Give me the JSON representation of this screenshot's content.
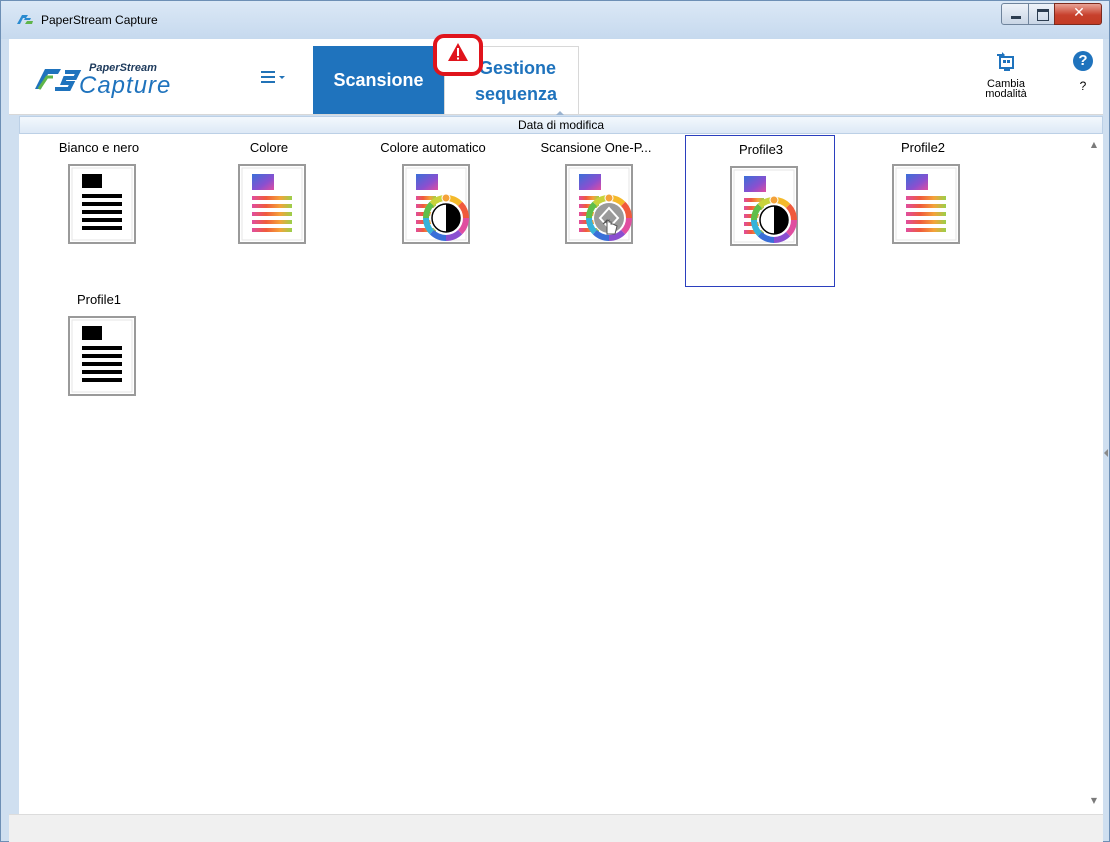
{
  "window": {
    "title": "PaperStream Capture"
  },
  "logo": {
    "top": "PaperStream",
    "bottom": "Capture"
  },
  "toolbar": {
    "menu_icon": "hamburger-menu-icon",
    "tab_scan": "Scansione",
    "tab_seq_line1": "Gestione",
    "tab_seq_line2": "sequenza",
    "mode_line1": "Cambia",
    "mode_line2": "modalità",
    "help_symbol": "?",
    "help_label": "?"
  },
  "sort": {
    "label": "Data di modifica"
  },
  "profiles": [
    {
      "label": "Bianco e nero",
      "icon": "bw-document-icon"
    },
    {
      "label": "Colore",
      "icon": "color-document-icon"
    },
    {
      "label": "Colore automatico",
      "icon": "auto-color-document-icon"
    },
    {
      "label": "Scansione One-P...",
      "icon": "one-push-scan-icon"
    },
    {
      "label": "Profile3",
      "icon": "auto-color-document-icon",
      "selected": true
    },
    {
      "label": "Profile2",
      "icon": "color-document-icon"
    },
    {
      "label": "Profile1",
      "icon": "bw-document-icon"
    }
  ],
  "colors": {
    "accent": "#1f73bd",
    "alert": "#e0141c",
    "selection": "#2b3fbe"
  }
}
